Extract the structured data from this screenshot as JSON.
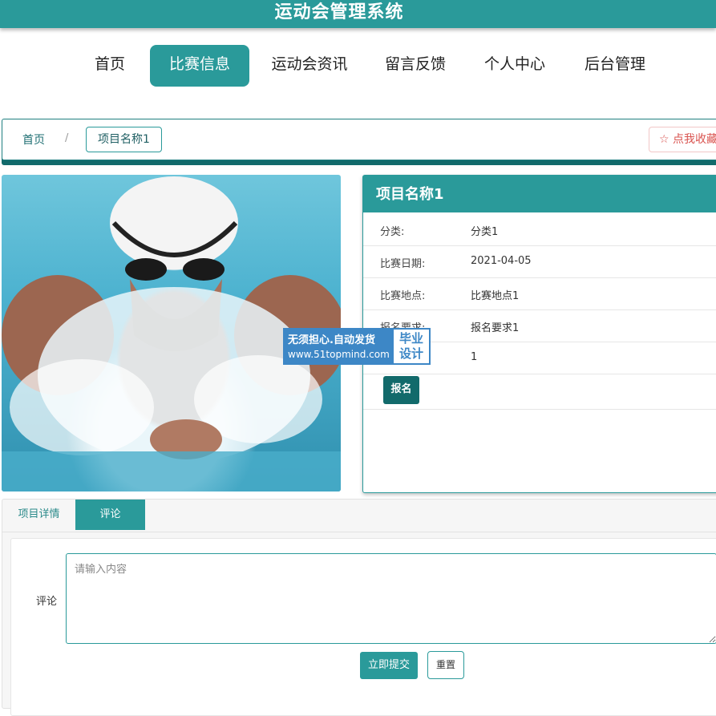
{
  "app": {
    "title": "运动会管理系统"
  },
  "nav": {
    "items": [
      {
        "label": "首页"
      },
      {
        "label": "比赛信息"
      },
      {
        "label": "运动会资讯"
      },
      {
        "label": "留言反馈"
      },
      {
        "label": "个人中心"
      },
      {
        "label": "后台管理"
      }
    ],
    "active_index": 1
  },
  "breadcrumb": {
    "home": "首页",
    "separator": "/",
    "current": "项目名称1",
    "favorite_label": "☆ 点我收藏"
  },
  "item": {
    "name": "项目名称1",
    "fields": [
      {
        "label": "分类:",
        "value": "分类1"
      },
      {
        "label": "比赛日期:",
        "value": "2021-04-05"
      },
      {
        "label": "比赛地点:",
        "value": "比赛地点1"
      },
      {
        "label": "报名要求:",
        "value": "报名要求1"
      },
      {
        "label": "",
        "value": "1"
      }
    ],
    "signup_label": "报名"
  },
  "watermark": {
    "line1": "无须担心.自动发货",
    "line2": "www.51topmind.com",
    "badge_line1": "毕业",
    "badge_line2": "设计"
  },
  "tabs": {
    "items": [
      {
        "label": "项目详情"
      },
      {
        "label": "评论"
      }
    ],
    "active_index": 1
  },
  "comment": {
    "label": "评论",
    "placeholder": "请输入内容",
    "value": "",
    "submit_label": "立即提交",
    "reset_label": "重置"
  },
  "colors": {
    "primary": "#2a9a9a",
    "primary_dark": "#126a6b",
    "favorite": "#d9534f"
  }
}
